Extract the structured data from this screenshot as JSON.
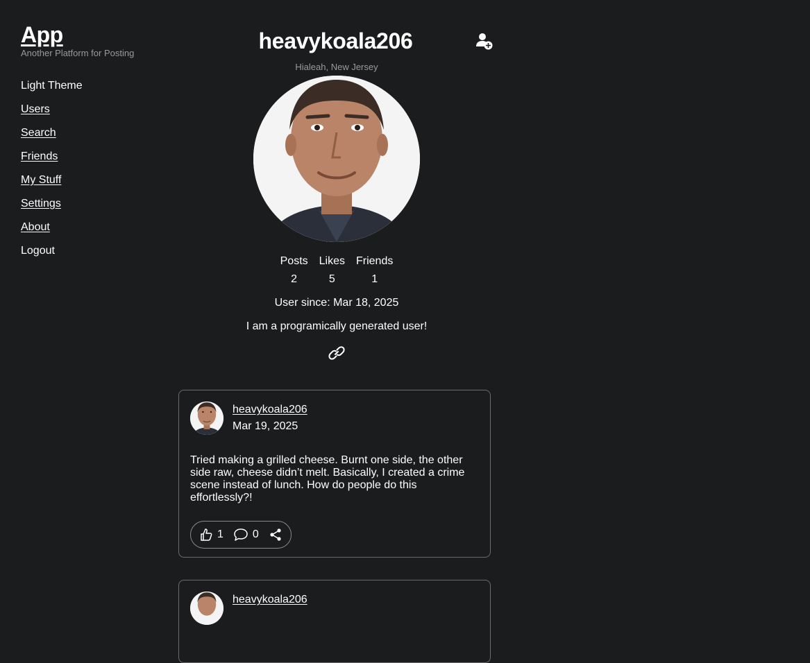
{
  "brand": {
    "title": "App",
    "subtitle": "Another Platform for Posting"
  },
  "nav": [
    {
      "label": "Light Theme",
      "link": false
    },
    {
      "label": "Users",
      "link": true
    },
    {
      "label": "Search",
      "link": true
    },
    {
      "label": "Friends",
      "link": true
    },
    {
      "label": "My Stuff",
      "link": true
    },
    {
      "label": "Settings",
      "link": true
    },
    {
      "label": "About",
      "link": true
    },
    {
      "label": "Logout",
      "link": false
    }
  ],
  "profile": {
    "username": "heavykoala206",
    "location": "Hialeah, New Jersey",
    "stats": {
      "posts_label": "Posts",
      "posts": "2",
      "likes_label": "Likes",
      "likes": "5",
      "friends_label": "Friends",
      "friends": "1"
    },
    "since": "User since: Mar 18, 2025",
    "bio": "I am a programically generated user!"
  },
  "posts": [
    {
      "user": "heavykoala206",
      "date": "Mar 19, 2025",
      "body": "Tried making a grilled cheese. Burnt one side, the other side raw, cheese didn’t melt. Basically, I created a crime scene instead of lunch. How do people do this effortlessly?!",
      "likes": "1",
      "comments": "0"
    },
    {
      "user": "heavykoala206"
    }
  ],
  "icons": {
    "add_friend": "user-plus-icon",
    "link": "link-icon",
    "like": "thumbs-up-icon",
    "comment": "comment-icon",
    "share": "share-icon"
  },
  "colors": {
    "background": "#1b1c1e",
    "text": "#ffffff",
    "muted": "#9a9a9a",
    "border": "#6c6c6e"
  }
}
